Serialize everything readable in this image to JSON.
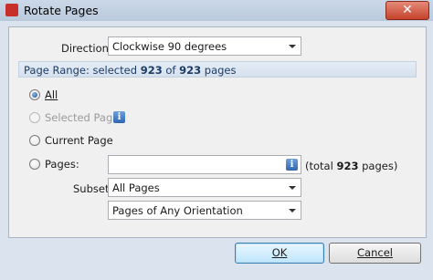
{
  "window": {
    "title": "Rotate Pages",
    "close_glyph": "✕"
  },
  "direction": {
    "label": "Direction:",
    "value": "Clockwise 90 degrees"
  },
  "page_range": {
    "prefix": "Page Range: selected ",
    "selected": "923",
    "middle": " of ",
    "total": "923",
    "suffix": " pages"
  },
  "options": {
    "all": {
      "label": "All",
      "checked": true
    },
    "selected_pages": {
      "label": "Selected Pages",
      "disabled": true
    },
    "current_page": {
      "label": "Current Page"
    },
    "pages": {
      "label": "Pages:",
      "value": "",
      "total_prefix": "(total ",
      "total_count": "923",
      "total_suffix": " pages)"
    }
  },
  "subset": {
    "label": "Subset:",
    "value": "All Pages",
    "orientation_value": "Pages of Any Orientation"
  },
  "buttons": {
    "ok": "OK",
    "cancel": "Cancel"
  },
  "icons": {
    "info": "i"
  }
}
